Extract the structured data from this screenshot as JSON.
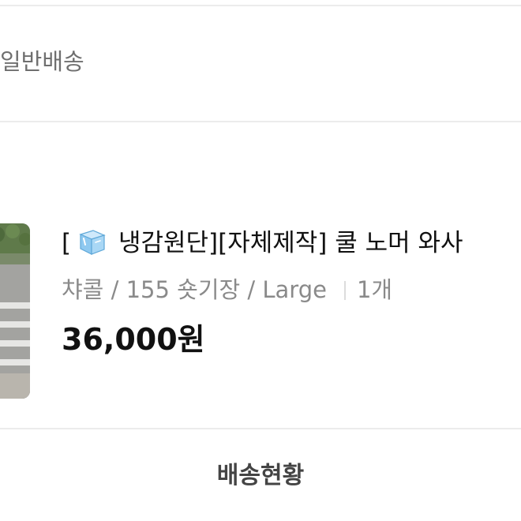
{
  "order": {
    "shipping_type": "일반배송",
    "product": {
      "title_open": "[",
      "title_icon": "ice-cube-icon",
      "title_rest": " 냉감원단][자체제작] 쿨 노머 와사",
      "options": "챠콜 / 155 숏기장 / Large",
      "quantity": "1개",
      "price": "36,000원"
    },
    "track_button_label": "배송현황"
  }
}
